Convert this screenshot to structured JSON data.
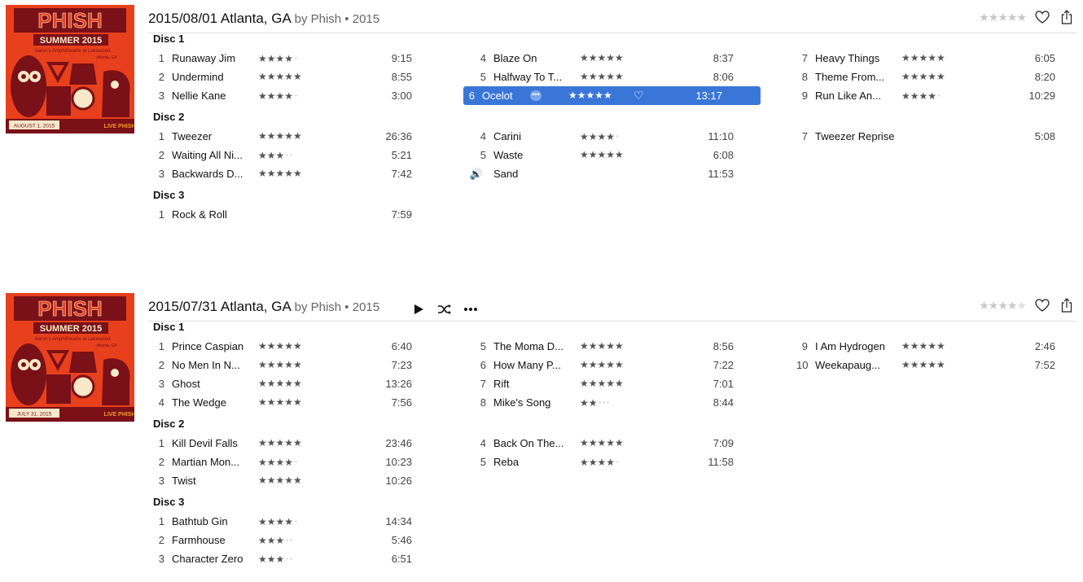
{
  "albums": [
    {
      "title": "2015/08/01 Atlanta, GA",
      "by": "by Phish • 2015",
      "art": {
        "band": "PHISH",
        "tour": "SUMMER 2015",
        "venue": "Aaron's Amphitheatre at Lakewood",
        "city": "Atlanta, GA",
        "date": "AUGUST 1, 2015",
        "brand": "LIVE PHISH",
        "colors": {
          "bg": "#e8401c",
          "dark": "#7a1018",
          "cream": "#f6e8c8",
          "orange": "#f59a23"
        }
      },
      "album_rating": 0,
      "discs": [
        {
          "label": "Disc 1",
          "columns": [
            [
              {
                "n": "1",
                "name": "Runaway Jim",
                "stars": 4,
                "time": "9:15"
              },
              {
                "n": "2",
                "name": "Undermind",
                "stars": 5,
                "time": "8:55"
              },
              {
                "n": "3",
                "name": "Nellie Kane",
                "stars": 4,
                "time": "3:00"
              }
            ],
            [
              {
                "n": "4",
                "name": "Blaze On",
                "stars": 5,
                "time": "8:37"
              },
              {
                "n": "5",
                "name": "Halfway To T...",
                "stars": 5,
                "time": "8:06"
              },
              {
                "n": "6",
                "name": "Ocelot",
                "stars": 5,
                "time": "13:17",
                "selected": true
              }
            ],
            [
              {
                "n": "7",
                "name": "Heavy Things",
                "stars": 5,
                "time": "6:05"
              },
              {
                "n": "8",
                "name": "Theme From...",
                "stars": 5,
                "time": "8:20"
              },
              {
                "n": "9",
                "name": "Run Like An...",
                "stars": 4,
                "time": "10:29"
              }
            ]
          ]
        },
        {
          "label": "Disc 2",
          "columns": [
            [
              {
                "n": "1",
                "name": "Tweezer",
                "stars": 5,
                "time": "26:36"
              },
              {
                "n": "2",
                "name": "Waiting All Ni...",
                "stars": 3,
                "time": "5:21"
              },
              {
                "n": "3",
                "name": "Backwards D...",
                "stars": 5,
                "time": "7:42"
              }
            ],
            [
              {
                "n": "4",
                "name": "Carini",
                "stars": 4,
                "time": "11:10"
              },
              {
                "n": "5",
                "name": "Waste",
                "stars": 5,
                "time": "6:08"
              },
              {
                "n": "",
                "name": "Sand",
                "stars": 0,
                "time": "11:53",
                "playing": true
              }
            ],
            [
              {
                "n": "7",
                "name": "Tweezer Reprise",
                "stars": 0,
                "time": "5:08"
              }
            ]
          ]
        },
        {
          "label": "Disc 3",
          "columns": [
            [
              {
                "n": "1",
                "name": "Rock & Roll",
                "stars": 0,
                "time": "7:59"
              }
            ],
            [],
            []
          ]
        }
      ]
    },
    {
      "title": "2015/07/31 Atlanta, GA",
      "by": "by Phish • 2015",
      "art": {
        "band": "PHISH",
        "tour": "SUMMER 2015",
        "venue": "Aaron's Amphitheatre at Lakewood",
        "city": "Atlanta, GA",
        "date": "JULY 31, 2015",
        "brand": "LIVE PHISH",
        "colors": {
          "bg": "#e8401c",
          "dark": "#7a1018",
          "cream": "#f6e8c8",
          "orange": "#f59a23"
        }
      },
      "album_rating": 4,
      "discs": [
        {
          "label": "Disc 1",
          "columns": [
            [
              {
                "n": "1",
                "name": "Prince Caspian",
                "stars": 5,
                "time": "6:40"
              },
              {
                "n": "2",
                "name": "No Men In N...",
                "stars": 5,
                "time": "7:23"
              },
              {
                "n": "3",
                "name": "Ghost",
                "stars": 5,
                "time": "13:26"
              },
              {
                "n": "4",
                "name": "The Wedge",
                "stars": 5,
                "time": "7:56"
              }
            ],
            [
              {
                "n": "5",
                "name": "The Moma D...",
                "stars": 5,
                "time": "8:56"
              },
              {
                "n": "6",
                "name": "How Many P...",
                "stars": 5,
                "time": "7:22"
              },
              {
                "n": "7",
                "name": "Rift",
                "stars": 5,
                "time": "7:01"
              },
              {
                "n": "8",
                "name": "Mike's Song",
                "stars": 2,
                "time": "8:44"
              }
            ],
            [
              {
                "n": "9",
                "name": "I Am Hydrogen",
                "stars": 5,
                "time": "2:46"
              },
              {
                "n": "10",
                "name": "Weekapaug...",
                "stars": 5,
                "time": "7:52"
              }
            ]
          ]
        },
        {
          "label": "Disc 2",
          "columns": [
            [
              {
                "n": "1",
                "name": "Kill Devil Falls",
                "stars": 5,
                "time": "23:46"
              },
              {
                "n": "2",
                "name": "Martian Mon...",
                "stars": 4,
                "time": "10:23"
              },
              {
                "n": "3",
                "name": "Twist",
                "stars": 5,
                "time": "10:26"
              }
            ],
            [
              {
                "n": "4",
                "name": "Back On The...",
                "stars": 5,
                "time": "7:09"
              },
              {
                "n": "5",
                "name": "Reba",
                "stars": 4,
                "time": "11:58"
              }
            ],
            []
          ]
        },
        {
          "label": "Disc 3",
          "columns": [
            [
              {
                "n": "1",
                "name": "Bathtub Gin",
                "stars": 4,
                "time": "14:34"
              },
              {
                "n": "2",
                "name": "Farmhouse",
                "stars": 3,
                "time": "5:46"
              },
              {
                "n": "3",
                "name": "Character Zero",
                "stars": 3,
                "time": "6:51"
              }
            ],
            [],
            []
          ]
        }
      ],
      "show_actions": true
    }
  ],
  "icons": {
    "heart": "heart-icon",
    "share": "share-icon",
    "play": "play-icon",
    "shuffle": "shuffle-icon",
    "more": "more-icon",
    "speaker": "speaker-icon"
  }
}
